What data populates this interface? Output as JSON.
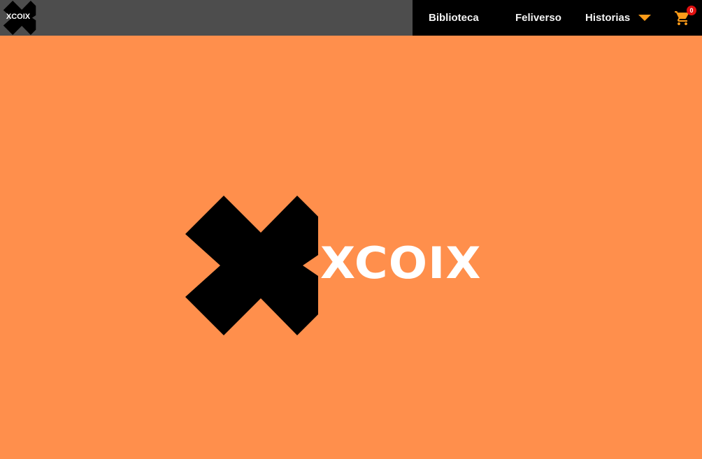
{
  "brand": {
    "small_logo_text": "XCOIX",
    "hero_logo_text": "XCOIX"
  },
  "nav": {
    "items": [
      {
        "label": "Biblioteca"
      },
      {
        "label": "Feliverso"
      },
      {
        "label": "Historias"
      }
    ],
    "historias_caret_icon": "chevron-down-icon"
  },
  "cart": {
    "icon": "shopping-cart-icon",
    "count": "0"
  },
  "colors": {
    "background": "#ff8f4c",
    "topbar_left": "#4d4d4d",
    "topbar_right": "#000000",
    "accent": "#ff9c19",
    "badge": "#e01010"
  }
}
